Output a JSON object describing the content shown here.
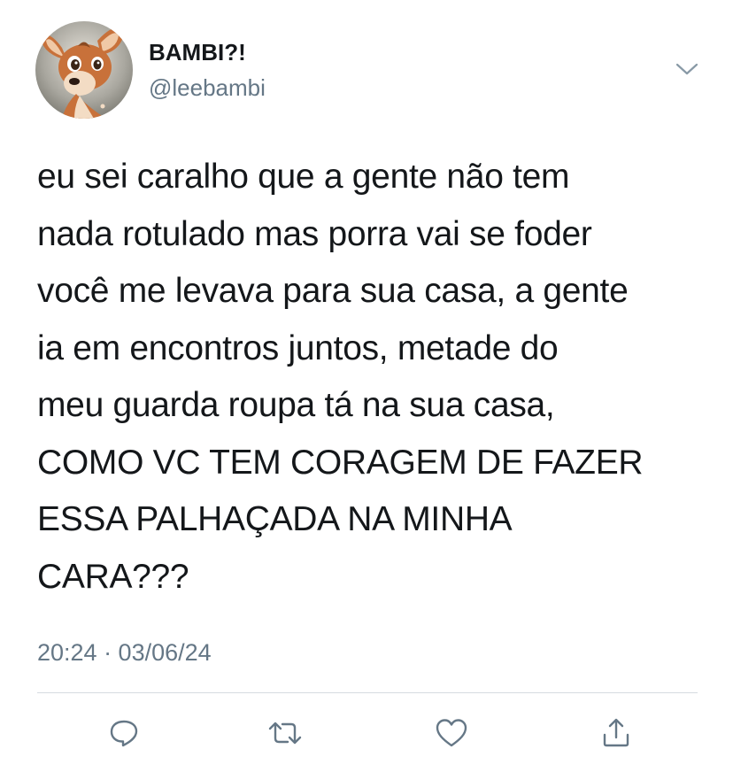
{
  "author": {
    "display_name": "BAMBI?!",
    "handle": "@leebambi",
    "avatar_icon": "bambi-avatar-icon"
  },
  "tweet": {
    "text": "eu sei caralho que a gente não tem\nnada rotulado mas porra vai se foder\nvocê me levava para sua casa, a gente\nia em encontros juntos, metade do\nmeu guarda roupa tá na sua casa,\nCOMO VC TEM CORAGEM DE FAZER\nESSA PALHAÇADA NA MINHA\nCARA???",
    "timestamp": "20:24 · 03/06/24"
  },
  "actions": {
    "reply_icon": "reply-icon",
    "retweet_icon": "retweet-icon",
    "like_icon": "heart-icon",
    "share_icon": "share-icon"
  },
  "colors": {
    "text": "#14171a",
    "secondary": "#657786",
    "divider": "#d6dbe0"
  }
}
